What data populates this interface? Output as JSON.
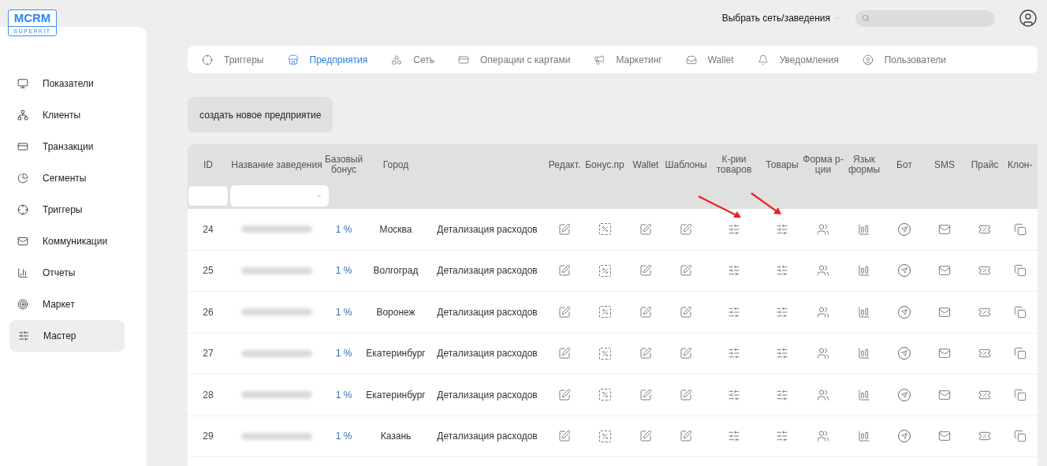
{
  "logo": {
    "title": "MCRM",
    "subtitle": "SUPERKIT"
  },
  "header": {
    "network_select": "Выбрать сеть/заведения"
  },
  "sidebar": {
    "items": [
      {
        "label": "Показатели",
        "selected": false
      },
      {
        "label": "Клиенты",
        "selected": false
      },
      {
        "label": "Транзакции",
        "selected": false
      },
      {
        "label": "Сегменты",
        "selected": false
      },
      {
        "label": "Триггеры",
        "selected": false
      },
      {
        "label": "Коммуникации",
        "selected": false
      },
      {
        "label": "Отчеты",
        "selected": false
      },
      {
        "label": "Маркет",
        "selected": false
      },
      {
        "label": "Мастер",
        "selected": true
      }
    ]
  },
  "tabs": [
    {
      "label": "Триггеры",
      "selected": false
    },
    {
      "label": "Предприятия",
      "selected": true
    },
    {
      "label": "Сеть",
      "selected": false
    },
    {
      "label": "Операции с картами",
      "selected": false
    },
    {
      "label": "Маркетинг",
      "selected": false
    },
    {
      "label": "Wallet",
      "selected": false
    },
    {
      "label": "Уведомления",
      "selected": false
    },
    {
      "label": "Пользователи",
      "selected": false
    }
  ],
  "create_button": "создать новое предприятие",
  "table": {
    "columns": [
      "ID",
      "Название заведения",
      "Базовый бонус",
      "Город",
      "Редакт.",
      "Бонус.пр",
      "Wallet",
      "Шаблоны",
      "К-рии товаров",
      "Товары",
      "Форма р-ции",
      "Язык формы",
      "Бот",
      "SMS",
      "Прайс",
      "Клон-"
    ],
    "rows": [
      {
        "id": "24",
        "bonus": "1 %",
        "city": "Москва",
        "detail": "Детализация расходов"
      },
      {
        "id": "25",
        "bonus": "1 %",
        "city": "Волгоград",
        "detail": "Детализация расходов"
      },
      {
        "id": "26",
        "bonus": "1 %",
        "city": "Воронеж",
        "detail": "Детализация расходов"
      },
      {
        "id": "27",
        "bonus": "1 %",
        "city": "Екатеринбург",
        "detail": "Детализация расходов"
      },
      {
        "id": "28",
        "bonus": "1 %",
        "city": "Екатеринбург",
        "detail": "Детализация расходов"
      },
      {
        "id": "29",
        "bonus": "1 %",
        "city": "Казань",
        "detail": "Детализация расходов"
      }
    ]
  }
}
